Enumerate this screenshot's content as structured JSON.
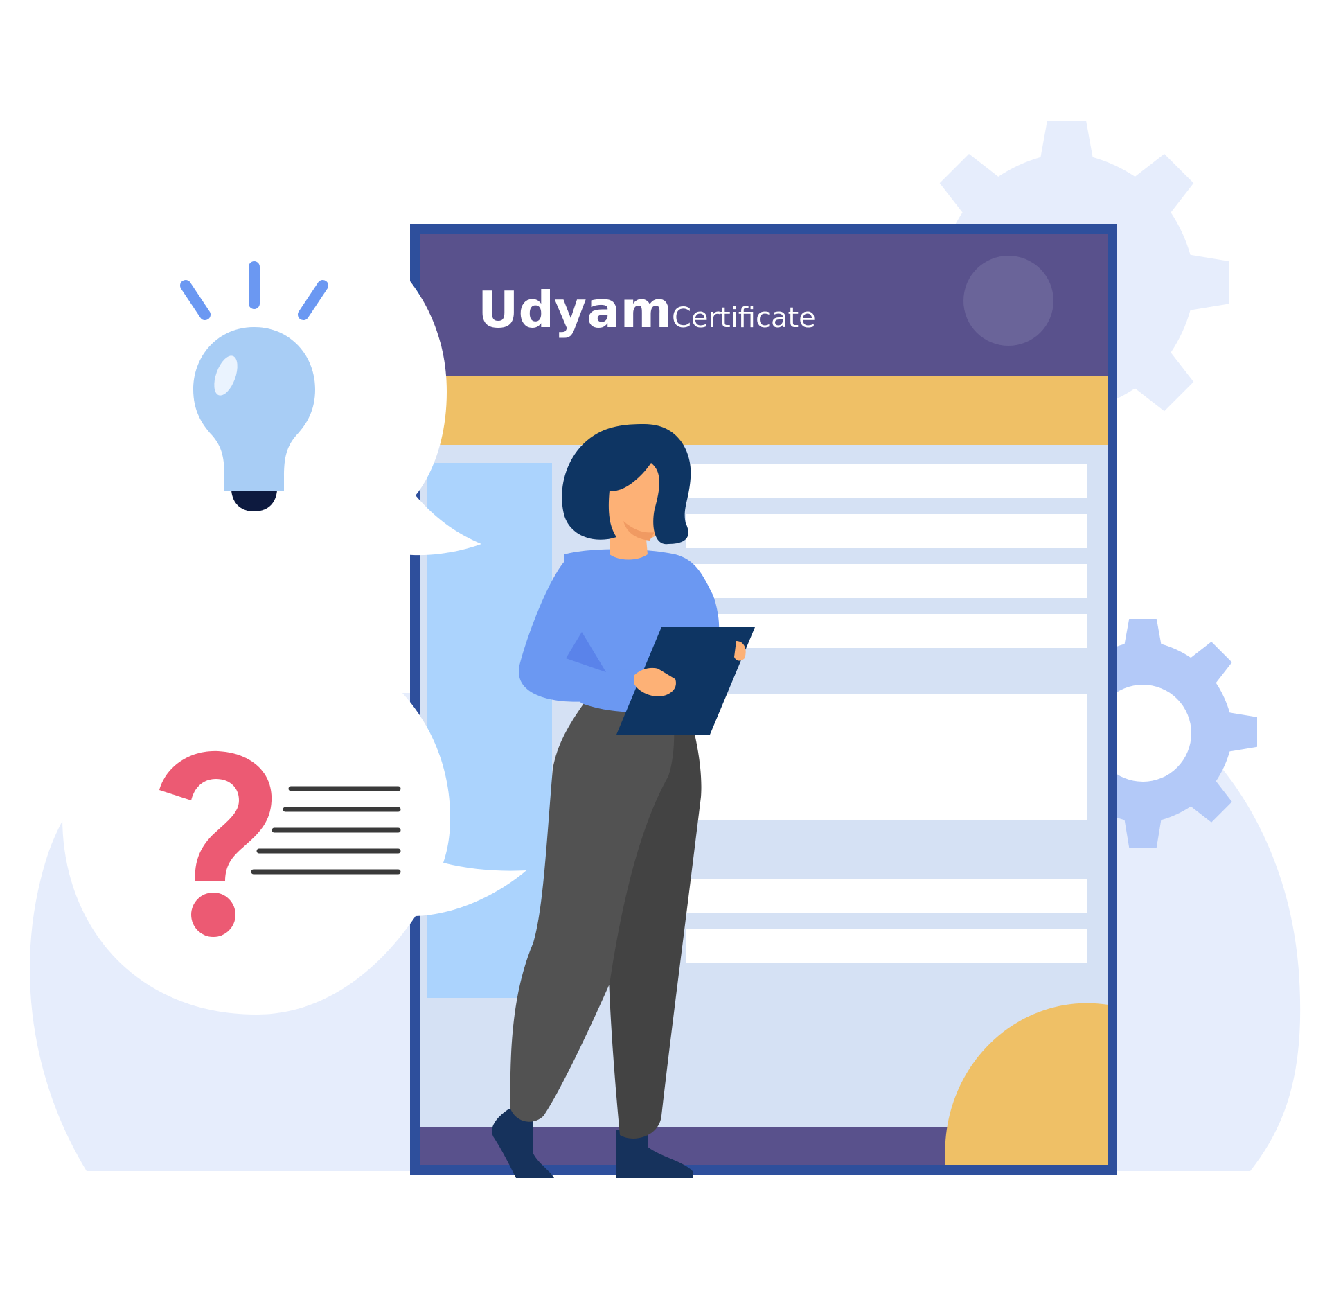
{
  "certificate": {
    "title": "Udyam",
    "subtitle": "Certificate"
  },
  "colors": {
    "frame": "#2e4f9c",
    "header": "#59518c",
    "yellow": "#efc066",
    "sheet": "#d5e1f4",
    "panel": "#abd3fd",
    "bubble_bg": "#e6edfc",
    "gear_light": "#e6edfc",
    "gear_accent": "#b3c9f8",
    "bulb": "#a8cdf5",
    "question_mark": "#ec5a73",
    "shirt": "#6b98f2",
    "hair": "#0e3563",
    "skin": "#fdb176",
    "pants_light": "#525252",
    "pants_dark": "#434343"
  },
  "icons": {
    "idea": "lightbulb-icon",
    "question": "question-mark-icon",
    "settings_large": "gear-icon",
    "settings_small": "gear-icon"
  }
}
